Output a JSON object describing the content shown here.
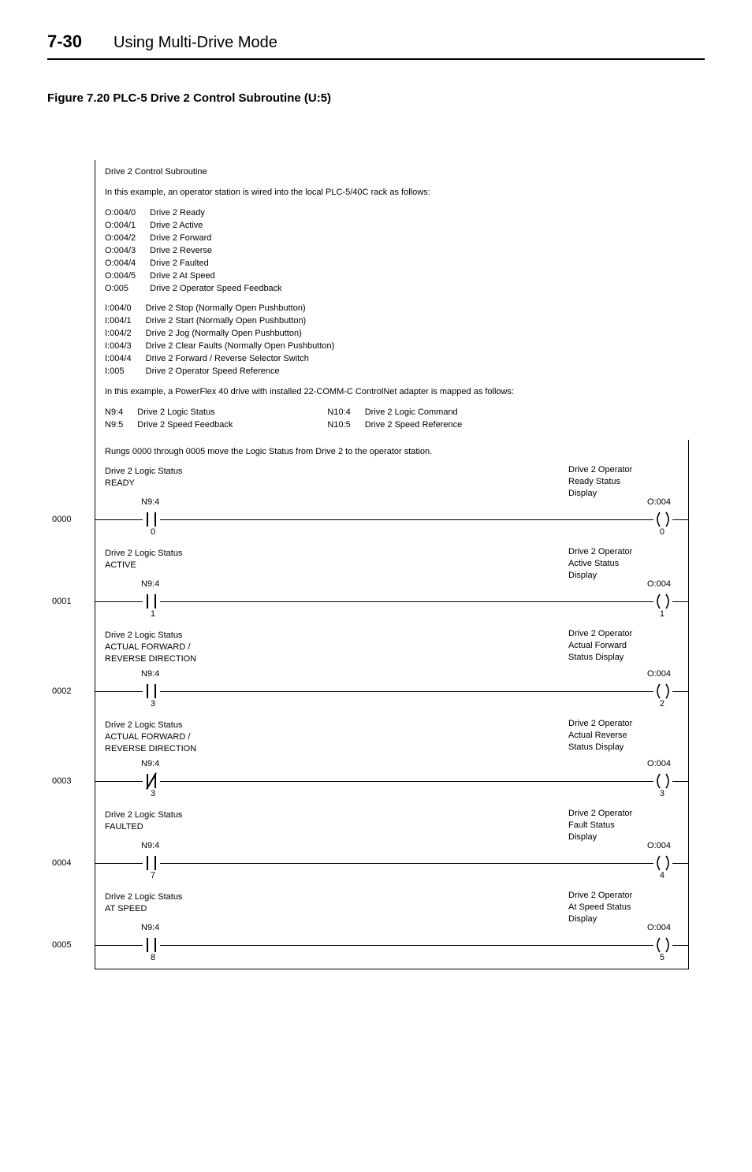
{
  "header": {
    "page_number": "7-30",
    "section_title": "Using Multi-Drive Mode"
  },
  "figure": {
    "caption": "Figure 7.20   PLC-5 Drive 2 Control Subroutine (U:5)"
  },
  "intro": {
    "block_title": "Drive 2 Control Subroutine",
    "wired_line": "In this example, an operator station is wired into the local PLC-5/40C rack as follows:",
    "o_lines": [
      [
        "O:004/0",
        "Drive 2 Ready"
      ],
      [
        "O:004/1",
        "Drive 2 Active"
      ],
      [
        "O:004/2",
        "Drive 2 Forward"
      ],
      [
        "O:004/3",
        "Drive 2 Reverse"
      ],
      [
        "O:004/4",
        "Drive 2 Faulted"
      ],
      [
        "O:004/5",
        "Drive 2 At Speed"
      ],
      [
        "O:005",
        "Drive 2 Operator Speed Feedback"
      ]
    ],
    "i_lines": [
      [
        "I:004/0",
        "Drive 2 Stop (Normally Open Pushbutton)"
      ],
      [
        "I:004/1",
        "Drive 2 Start (Normally Open Pushbutton)"
      ],
      [
        "I:004/2",
        "Drive 2 Jog (Normally Open Pushbutton)"
      ],
      [
        "I:004/3",
        "Drive 2 Clear Faults (Normally Open Pushbutton)"
      ],
      [
        "I:004/4",
        "Drive 2 Forward / Reverse Selector Switch"
      ],
      [
        "I:005",
        "Drive 2 Operator Speed Reference"
      ]
    ],
    "mapped_line": "In this example, a PowerFlex 40 drive with installed 22-COMM-C ControlNet adapter is mapped as follows:",
    "map_left": [
      [
        "N9:4",
        "Drive 2 Logic Status"
      ],
      [
        "N9:5",
        "Drive 2 Speed Feedback"
      ]
    ],
    "map_right": [
      [
        "N10:4",
        "Drive 2 Logic Command"
      ],
      [
        "N10:5",
        "Drive 2 Speed Reference"
      ]
    ],
    "rung_intro": "Rungs 0000 through 0005 move the Logic Status from Drive 2 to the operator station."
  },
  "rungs": [
    {
      "num": "0000",
      "left_label": "Drive 2 Logic Status\nREADY",
      "left_addr": "N9:4",
      "left_bit": "0",
      "right_label": "Drive 2 Operator\nReady Status\nDisplay",
      "right_addr": "O:004",
      "right_bit": "0",
      "xio": false
    },
    {
      "num": "0001",
      "left_label": "Drive 2 Logic Status\nACTIVE",
      "left_addr": "N9:4",
      "left_bit": "1",
      "right_label": "Drive 2 Operator\nActive Status\nDisplay",
      "right_addr": "O:004",
      "right_bit": "1",
      "xio": false
    },
    {
      "num": "0002",
      "left_label": "Drive 2 Logic Status\nACTUAL FORWARD /\nREVERSE DIRECTION",
      "left_addr": "N9:4",
      "left_bit": "3",
      "right_label": "Drive 2 Operator\nActual Forward\nStatus Display",
      "right_addr": "O:004",
      "right_bit": "2",
      "xio": false
    },
    {
      "num": "0003",
      "left_label": "Drive 2 Logic Status\nACTUAL FORWARD /\nREVERSE DIRECTION",
      "left_addr": "N9:4",
      "left_bit": "3",
      "right_label": "Drive 2 Operator\nActual Reverse\nStatus Display",
      "right_addr": "O:004",
      "right_bit": "3",
      "xio": true
    },
    {
      "num": "0004",
      "left_label": "Drive 2 Logic Status\nFAULTED",
      "left_addr": "N9:4",
      "left_bit": "7",
      "right_label": "Drive 2 Operator\nFault Status\nDisplay",
      "right_addr": "O:004",
      "right_bit": "4",
      "xio": false
    },
    {
      "num": "0005",
      "left_label": "Drive 2 Logic Status\nAT SPEED",
      "left_addr": "N9:4",
      "left_bit": "8",
      "right_label": "Drive 2 Operator\nAt Speed Status\nDisplay",
      "right_addr": "O:004",
      "right_bit": "5",
      "xio": false
    }
  ]
}
